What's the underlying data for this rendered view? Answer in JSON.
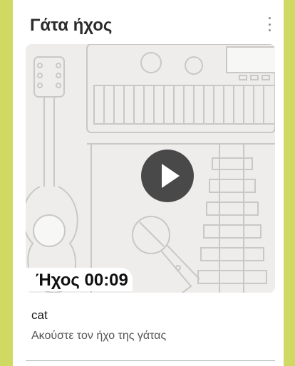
{
  "card": {
    "title": "Γάτα ήχος",
    "menu_icon": "more-vert-icon",
    "media": {
      "play_icon": "play-icon",
      "duration_label": "Ήχος 00:09"
    },
    "item_title": "cat",
    "item_description": "Ακούστε τον ήχο της γάτας"
  },
  "colors": {
    "background_accent": "#d0da62",
    "card": "#ffffff",
    "play_button": "#4a4949"
  }
}
